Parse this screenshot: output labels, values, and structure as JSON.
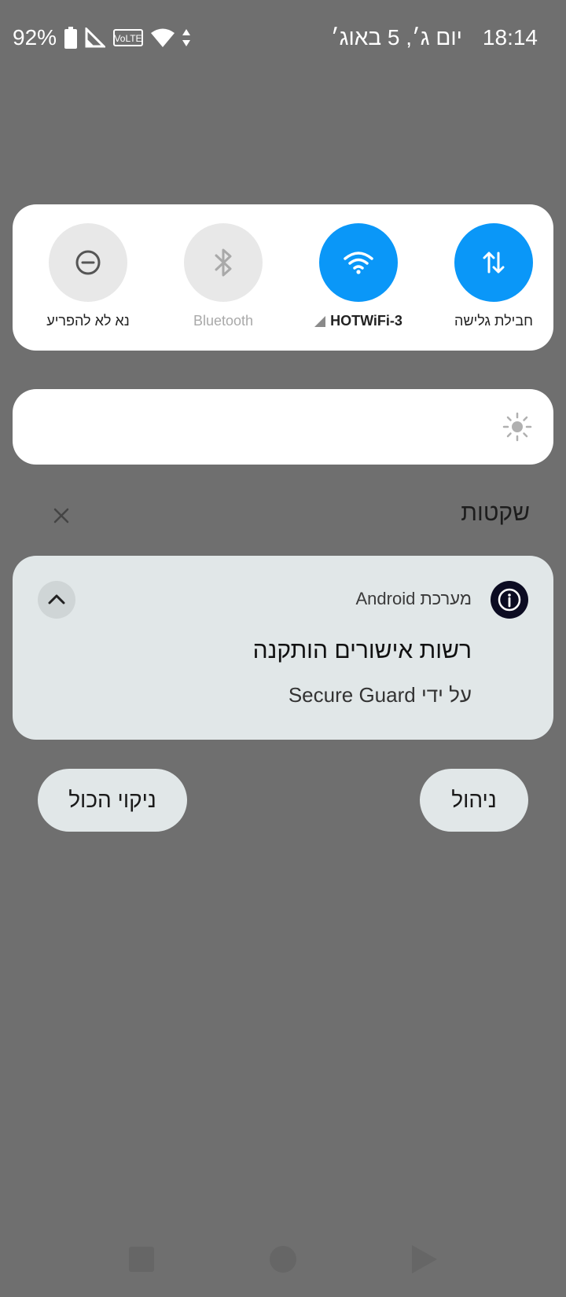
{
  "status_bar": {
    "battery_percent": "92%",
    "date": "יום ג׳, 5 באוג׳",
    "time": "18:14",
    "volte_label": "VoLTE",
    "icons": [
      "battery-icon",
      "signal-icon",
      "volte-icon",
      "wifi-icon",
      "data-arrows-icon"
    ]
  },
  "quick_settings": {
    "tiles": [
      {
        "label": "חבילת גלישה",
        "state": "on",
        "icon": "mobile-data-icon"
      },
      {
        "label": "HOTWiFi-3",
        "state": "on",
        "icon": "wifi-icon"
      },
      {
        "label": "Bluetooth",
        "state": "off",
        "icon": "bluetooth-icon"
      },
      {
        "label": "נא לא להפריע",
        "state": "off",
        "icon": "do-not-disturb-icon"
      }
    ],
    "accent_color": "#0a97f8"
  },
  "brightness": {
    "icon": "brightness-icon"
  },
  "notifications": {
    "section_title": "שקטות",
    "items": [
      {
        "app_name": "מערכת Android",
        "title": "רשות אישורים הותקנה",
        "text": "על ידי Secure Guard"
      }
    ],
    "manage_label": "ניהול",
    "clear_all_label": "ניקוי הכול"
  }
}
